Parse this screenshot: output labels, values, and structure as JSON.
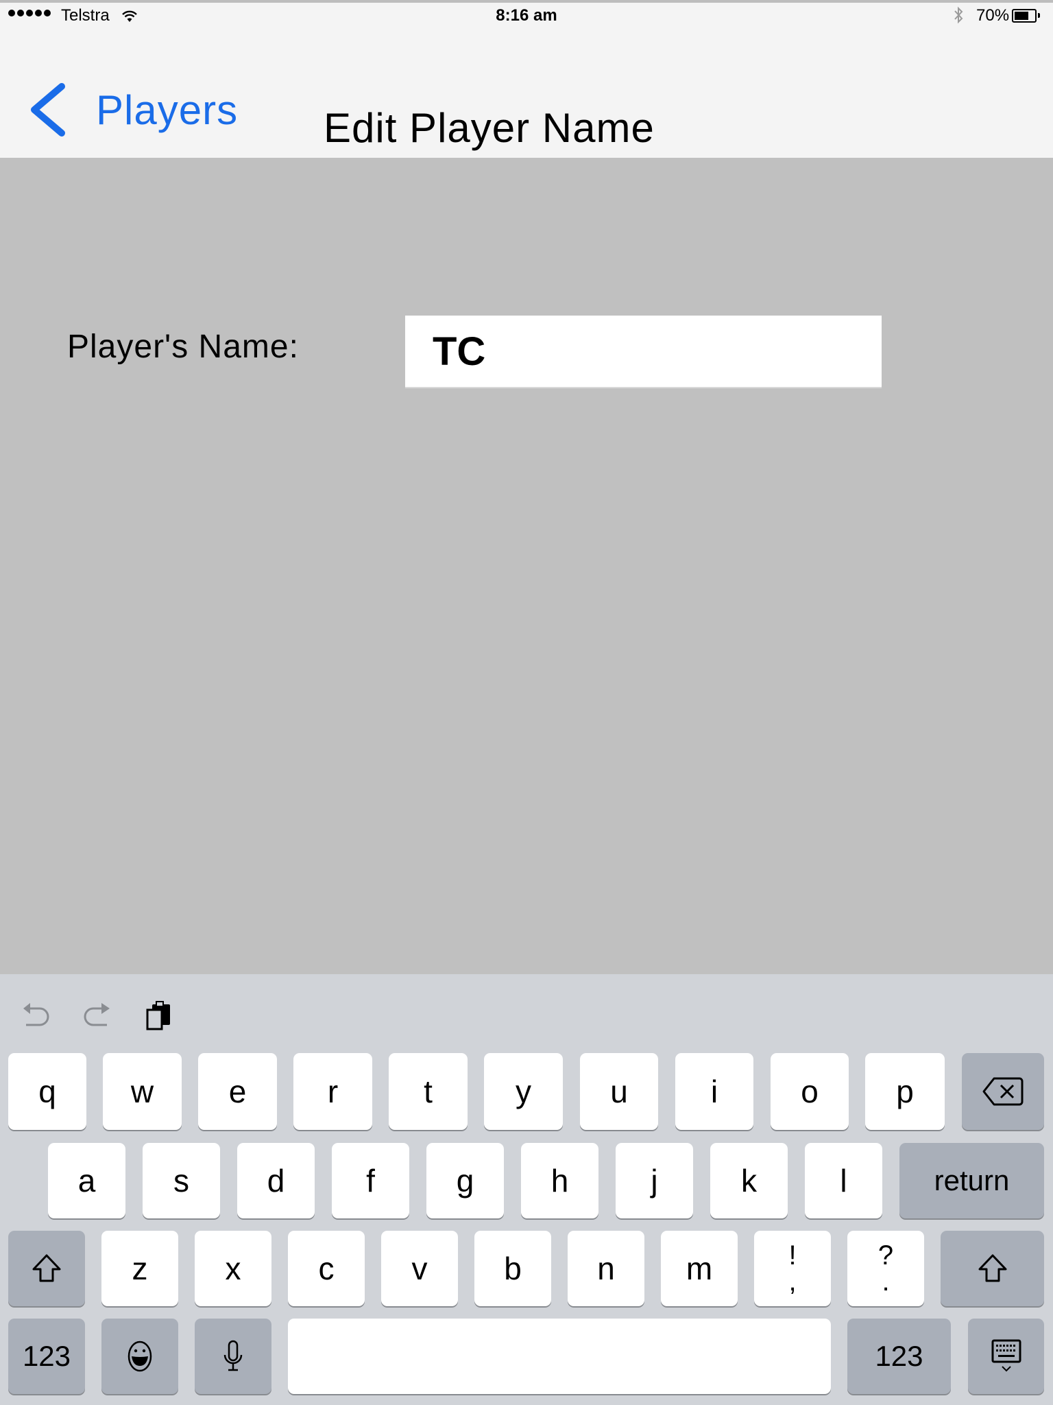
{
  "status_bar": {
    "signal_bars": 5,
    "carrier": "Telstra",
    "time": "8:16 am",
    "battery_percent_label": "70%",
    "battery_level": 0.7,
    "icons": [
      "signal-dots-icon",
      "wifi-icon",
      "bluetooth-icon",
      "battery-icon"
    ]
  },
  "nav": {
    "back_label": "Players",
    "title": "Edit Player Name",
    "accent_color": "#1a6ce8"
  },
  "form": {
    "name_label": "Player's Name:",
    "name_value": "TC"
  },
  "keyboard": {
    "toolbar": [
      "undo-icon",
      "redo-icon",
      "paste-icon"
    ],
    "row1": [
      "q",
      "w",
      "e",
      "r",
      "t",
      "y",
      "u",
      "i",
      "o",
      "p"
    ],
    "row2": [
      "a",
      "s",
      "d",
      "f",
      "g",
      "h",
      "j",
      "k",
      "l"
    ],
    "row3": [
      "z",
      "x",
      "c",
      "v",
      "b",
      "n",
      "m"
    ],
    "punct1": {
      "top": "!",
      "bottom": ","
    },
    "punct2": {
      "top": "?",
      "bottom": "."
    },
    "return_label": "return",
    "numbers_label": "123",
    "numbers_label_right": "123"
  }
}
